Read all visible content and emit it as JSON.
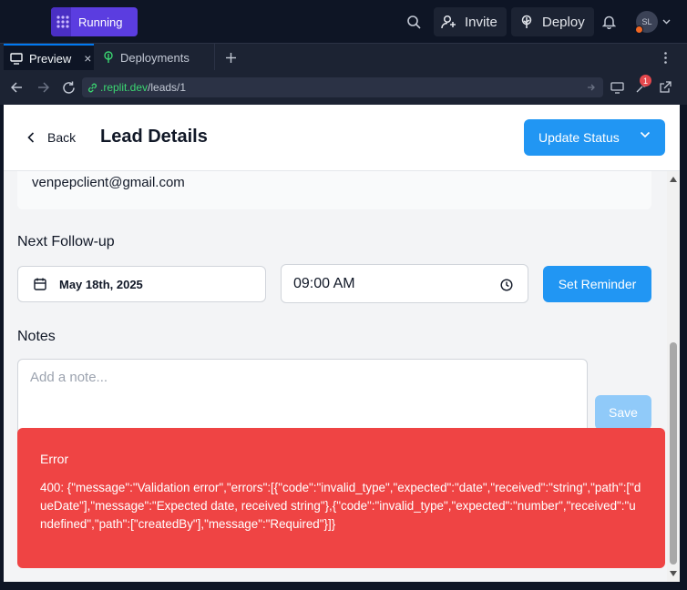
{
  "topbar": {
    "run_label": "Running",
    "invite_label": "Invite",
    "deploy_label": "Deploy",
    "avatar_initials": "SL",
    "brand_color": "#5b3de0"
  },
  "tabs": [
    {
      "label": "Preview",
      "close": "×",
      "active": true
    },
    {
      "label": "Deployments",
      "active": false
    }
  ],
  "browser": {
    "url_host": ".replit.dev",
    "url_path": "/leads/1",
    "notification_count": "1"
  },
  "page": {
    "back_label": "Back",
    "title": "Lead Details",
    "update_status_label": "Update Status",
    "email": "venpepclient@gmail.com",
    "follow_up_label": "Next Follow-up",
    "date_value": "May 18th, 2025",
    "time_value": "09:00 AM",
    "set_reminder_label": "Set Reminder",
    "notes_label": "Notes",
    "note_placeholder": "Add a note...",
    "save_label": "Save",
    "accent_color": "#2196f3"
  },
  "toast": {
    "title": "Error",
    "message": "400: {\"message\":\"Validation error\",\"errors\":[{\"code\":\"invalid_type\",\"expected\":\"date\",\"received\":\"string\",\"path\":[\"dueDate\"],\"message\":\"Expected date, received string\"},{\"code\":\"invalid_type\",\"expected\":\"number\",\"received\":\"undefined\",\"path\":[\"createdBy\"],\"message\":\"Required\"}]}",
    "color": "#ef4444"
  }
}
